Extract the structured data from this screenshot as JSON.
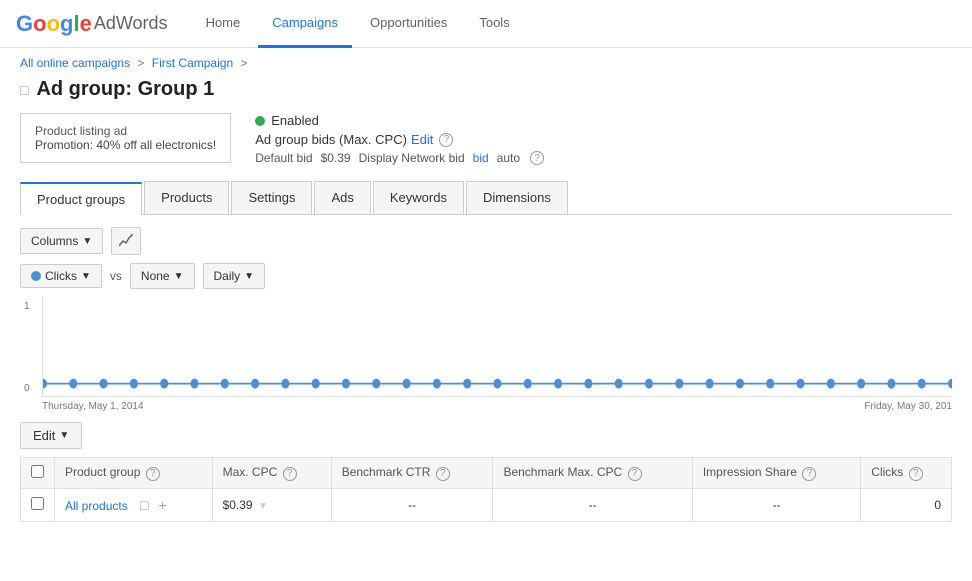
{
  "app": {
    "logo_letters": [
      "G",
      "o",
      "o",
      "g",
      "l",
      "e"
    ],
    "logo_product": "AdWords"
  },
  "nav": {
    "links": [
      {
        "label": "Home",
        "active": false
      },
      {
        "label": "Campaigns",
        "active": true
      },
      {
        "label": "Opportunities",
        "active": false
      },
      {
        "label": "Tools",
        "active": false
      }
    ]
  },
  "breadcrumb": {
    "all_label": "All online campaigns",
    "campaign_label": "First Campaign",
    "sep": ">"
  },
  "page_title": {
    "prefix": "Ad group:",
    "group_name": "Group 1"
  },
  "ad_box": {
    "title": "Product listing ad",
    "promo": "Promotion: 40% off all electronics!"
  },
  "ad_settings": {
    "status": "Enabled",
    "bids_label": "Ad group bids (Max. CPC)",
    "edit_label": "Edit",
    "default_bid_label": "Default bid",
    "default_bid_value": "$0.39",
    "display_network_label": "Display Network bid",
    "display_network_value": "auto"
  },
  "tabs": [
    {
      "label": "Product groups",
      "active": true
    },
    {
      "label": "Products",
      "active": false
    },
    {
      "label": "Settings",
      "active": false
    },
    {
      "label": "Ads",
      "active": false
    },
    {
      "label": "Keywords",
      "active": false
    },
    {
      "label": "Dimensions",
      "active": false
    }
  ],
  "chart_controls": {
    "columns_label": "Columns",
    "clicks_label": "Clicks",
    "vs_label": "vs",
    "none_label": "None",
    "daily_label": "Daily"
  },
  "chart": {
    "y_top": "1",
    "y_bottom": "0",
    "date_start": "Thursday, May 1, 2014",
    "date_end": "Friday, May 30, 201"
  },
  "edit_toolbar": {
    "edit_label": "Edit"
  },
  "table": {
    "headers": [
      {
        "label": "Product group",
        "has_help": true
      },
      {
        "label": "Max. CPC",
        "has_help": true
      },
      {
        "label": "Benchmark CTR",
        "has_help": true
      },
      {
        "label": "Benchmark Max. CPC",
        "has_help": true
      },
      {
        "label": "Impression Share",
        "has_help": true
      },
      {
        "label": "Clicks",
        "has_help": true
      }
    ],
    "rows": [
      {
        "name": "All products",
        "max_cpc": "$0.39",
        "benchmark_ctr": "--",
        "benchmark_max_cpc": "--",
        "impression_share": "--",
        "clicks": "0"
      }
    ]
  }
}
